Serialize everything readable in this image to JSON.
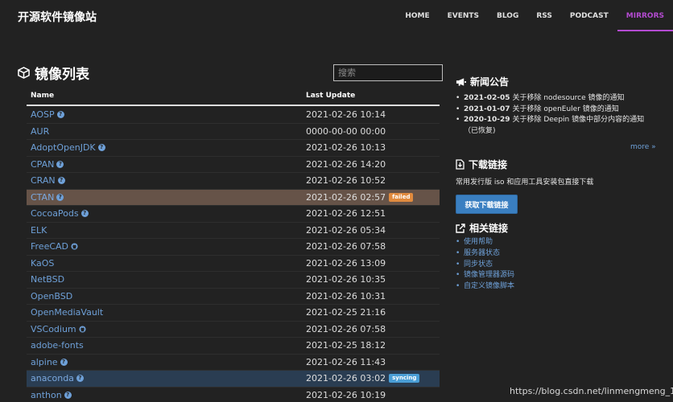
{
  "brand": "开源软件镜像站",
  "nav": [
    {
      "label": "HOME",
      "active": false
    },
    {
      "label": "EVENTS",
      "active": false
    },
    {
      "label": "BLOG",
      "active": false
    },
    {
      "label": "RSS",
      "active": false
    },
    {
      "label": "PODCAST",
      "active": false
    },
    {
      "label": "MIRRORS",
      "active": true
    }
  ],
  "mirrors": {
    "title": "镜像列表",
    "search_placeholder": "搜索",
    "columns": {
      "name": "Name",
      "last_update": "Last Update"
    },
    "rows": [
      {
        "name": "AOSP",
        "date": "2021-02-26 10:14",
        "icon": "help-icon",
        "status": ""
      },
      {
        "name": "AUR",
        "date": "0000-00-00 00:00",
        "icon": "",
        "status": ""
      },
      {
        "name": "AdoptOpenJDK",
        "date": "2021-02-26 10:13",
        "icon": "help-icon",
        "status": ""
      },
      {
        "name": "CPAN",
        "date": "2021-02-26 14:20",
        "icon": "help-icon",
        "status": ""
      },
      {
        "name": "CRAN",
        "date": "2021-02-26 10:52",
        "icon": "help-icon",
        "status": ""
      },
      {
        "name": "CTAN",
        "date": "2021-02-26 02:57",
        "icon": "help-icon",
        "status": "failed"
      },
      {
        "name": "CocoaPods",
        "date": "2021-02-26 12:51",
        "icon": "help-icon",
        "status": ""
      },
      {
        "name": "ELK",
        "date": "2021-02-26 05:34",
        "icon": "",
        "status": ""
      },
      {
        "name": "FreeCAD",
        "date": "2021-02-26 07:58",
        "icon": "github-icon",
        "status": ""
      },
      {
        "name": "KaOS",
        "date": "2021-02-26 13:09",
        "icon": "",
        "status": ""
      },
      {
        "name": "NetBSD",
        "date": "2021-02-26 10:35",
        "icon": "",
        "status": ""
      },
      {
        "name": "OpenBSD",
        "date": "2021-02-26 10:31",
        "icon": "",
        "status": ""
      },
      {
        "name": "OpenMediaVault",
        "date": "2021-02-25 21:16",
        "icon": "",
        "status": ""
      },
      {
        "name": "VSCodium",
        "date": "2021-02-26 07:58",
        "icon": "github-icon",
        "status": ""
      },
      {
        "name": "adobe-fonts",
        "date": "2021-02-25 18:12",
        "icon": "",
        "status": ""
      },
      {
        "name": "alpine",
        "date": "2021-02-26 11:43",
        "icon": "help-icon",
        "status": ""
      },
      {
        "name": "anaconda",
        "date": "2021-02-26 03:02",
        "icon": "help-icon",
        "status": "syncing"
      },
      {
        "name": "anthon",
        "date": "2021-02-26 10:19",
        "icon": "help-icon",
        "status": ""
      }
    ]
  },
  "news": {
    "title": "新闻公告",
    "items": [
      {
        "date": "2021-02-05",
        "text": "关于移除 nodesource 镜像的通知"
      },
      {
        "date": "2021-01-07",
        "text": "关于移除 openEuler 镜像的通知"
      },
      {
        "date": "2020-10-29",
        "text": "关于移除 Deepin 镜像中部分内容的通知（已恢复)"
      }
    ],
    "more": "more »"
  },
  "download": {
    "title": "下载链接",
    "desc": "常用发行版 iso 和应用工具安装包直接下载",
    "button": "获取下载链接"
  },
  "related": {
    "title": "相关链接",
    "links": [
      "使用帮助",
      "服务器状态",
      "同步状态",
      "镜像管理器源码",
      "自定义镜像脚本"
    ]
  },
  "watermark": "https://blog.csdn.net/linmengmeng_1314",
  "colors": {
    "accent": "#b44bd1",
    "link": "#6ea0d8",
    "failed": "#e08a3e",
    "syncing": "#4a9ed6"
  }
}
